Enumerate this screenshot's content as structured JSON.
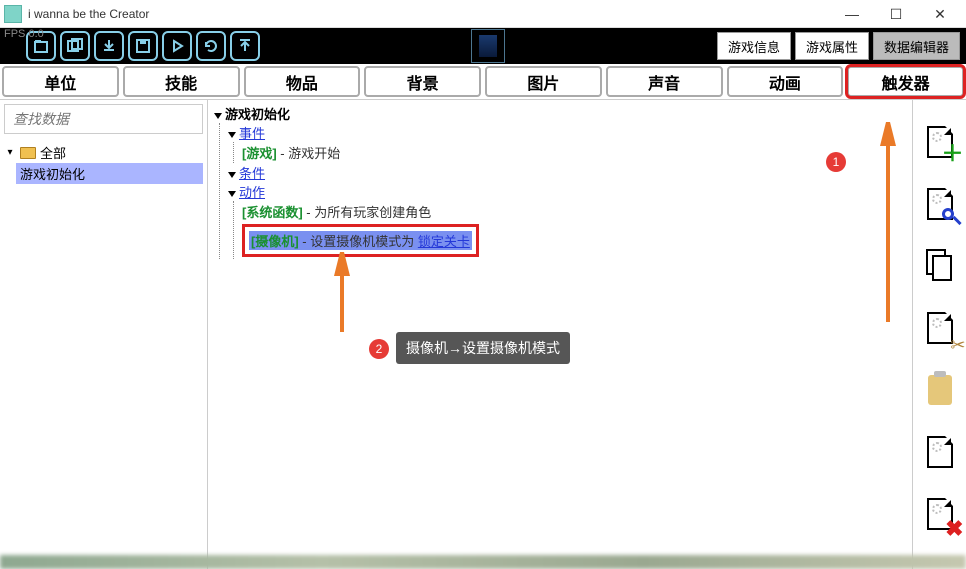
{
  "window": {
    "title": "i wanna be the Creator",
    "fps": "FPS 0.0"
  },
  "header_buttons": {
    "info": "游戏信息",
    "attrs": "游戏属性",
    "editor": "数据编辑器"
  },
  "tabs": [
    "单位",
    "技能",
    "物品",
    "背景",
    "图片",
    "声音",
    "动画",
    "触发器"
  ],
  "search": {
    "placeholder": "查找数据"
  },
  "folder": {
    "root": "全部",
    "item": "游戏初始化"
  },
  "trigger": {
    "root": "游戏初始化",
    "events_label": "事件",
    "event_prefix": "[游戏]",
    "event_text": " - 游戏开始",
    "conditions_label": "条件",
    "actions_label": "动作",
    "act1_prefix": "[系统函数]",
    "act1_text": " - 为所有玩家创建角色",
    "act2_prefix": "[摄像机]",
    "act2_mid": " - 设置摄像机模式为 ",
    "act2_link": "锁定关卡"
  },
  "callouts": {
    "b1": "1",
    "b2": "2",
    "text2": "摄像机→设置摄像机模式"
  }
}
